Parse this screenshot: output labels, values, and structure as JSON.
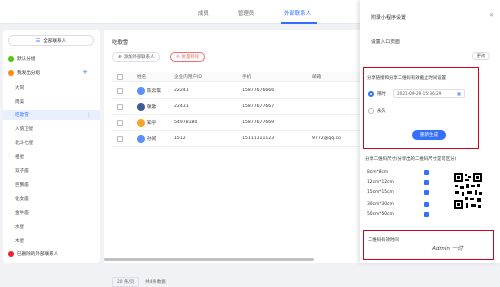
{
  "tabs": [
    {
      "label": "成员"
    },
    {
      "label": "管理员"
    },
    {
      "label": "外部联系人"
    }
  ],
  "sidebar": {
    "all_button": "全部联系人",
    "default_group": "默认分组",
    "mine_group": "我发出分组",
    "items": [
      {
        "label": "大同"
      },
      {
        "label": "周美"
      },
      {
        "label": "吃歌雪"
      },
      {
        "label": "入值卫星"
      },
      {
        "label": "北斗七星"
      },
      {
        "label": "祖星"
      },
      {
        "label": "双子座"
      },
      {
        "label": "巨蟹座"
      },
      {
        "label": "化女座"
      },
      {
        "label": "金牛座"
      },
      {
        "label": "水星"
      },
      {
        "label": "木星"
      }
    ],
    "bottom_group": "已删除的外部联系人"
  },
  "main": {
    "title": "吃歌雪",
    "add_button": "添加外部联系人",
    "remove_button": "批量移除",
    "columns": [
      "姓名",
      "企业内用户ID",
      "手机",
      "邮箱"
    ],
    "rows": [
      {
        "name": "陈云琪",
        "uid": "22241",
        "phone": "15877676666",
        "email": ""
      },
      {
        "name": "敬歌",
        "uid": "22431",
        "phone": "15877677667",
        "email": ""
      },
      {
        "name": "知乎",
        "uid": "54978180",
        "phone": "15877677669",
        "email": ""
      },
      {
        "name": "孙闲",
        "uid": "1512",
        "phone": "15111111123",
        "email": "9772@qq.co"
      }
    ],
    "avatar_colors": [
      "#5b8ff9",
      "#3f5b9a",
      "#f6a623",
      "#5b8ff9"
    ],
    "pager": {
      "page_size": "20 条/页",
      "total": "共4条数据"
    }
  },
  "panel": {
    "title": "附录小程序设置",
    "set_homepage": "设置入口页面",
    "change_button": "更改",
    "share_title": "分享链接和分享二维码有效截止时间设置",
    "timed_label": "限时",
    "datetime": "2021-09-29 15:36:29",
    "forever_label": "永久",
    "generate_button": "重新生成",
    "qr_title": "分享二维码尺寸(分享出的二维码尺寸是可区分)",
    "sizes": [
      {
        "label": "8cm*8cm"
      },
      {
        "label": "12cm*12cm"
      },
      {
        "label": "15cm*15cm"
      },
      {
        "label": "30cm*30cm"
      },
      {
        "label": "50cm*50cm"
      }
    ],
    "qr_validity": "二维码有效时间",
    "watermark": "Admin 一讨"
  },
  "colors": {
    "accent": "#3370ff",
    "highlight": "#d0021b",
    "danger": "#f56c6c"
  }
}
